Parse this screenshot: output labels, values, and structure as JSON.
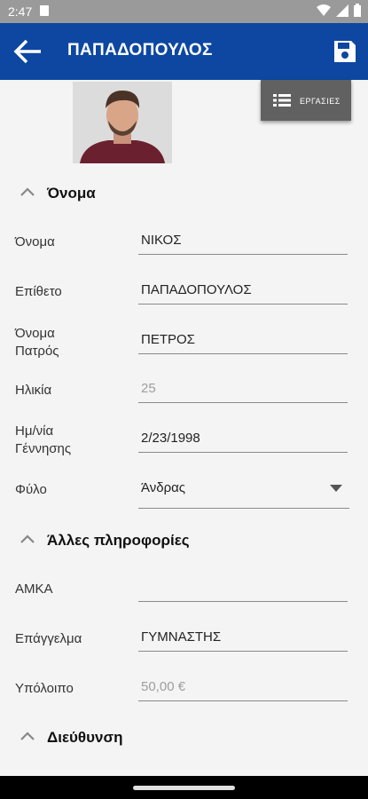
{
  "status_bar": {
    "time": "2:47"
  },
  "app_bar": {
    "title": "ΠΑΠΑΔΟΠΟΥΛΟΣ"
  },
  "tasks_button": {
    "label": "ΕΡΓΑΣΙΕΣ"
  },
  "sections": {
    "name": {
      "title": "Όνομα"
    },
    "other": {
      "title": "Άλλες πληροφορίες"
    },
    "address": {
      "title": "Διεύθυνση"
    }
  },
  "fields": {
    "first_name": {
      "label": "Όνομα",
      "value": "ΝΙΚΟΣ"
    },
    "last_name": {
      "label": "Επίθετο",
      "value": "ΠΑΠΑΔΟΠΟΥΛΟΣ"
    },
    "father_name": {
      "label_line1": "Όνομα",
      "label_line2": "Πατρός",
      "value": "ΠΕΤΡΟΣ"
    },
    "age": {
      "label": "Ηλικία",
      "value": "25"
    },
    "birth_date": {
      "label_line1": "Ημ/νία",
      "label_line2": "Γέννησης",
      "value": "2/23/1998"
    },
    "gender": {
      "label": "Φύλο",
      "value": "Άνδρας"
    },
    "amka": {
      "label": "ΑΜΚΑ",
      "value": ""
    },
    "profession": {
      "label": "Επάγγελμα",
      "value": "ΓΥΜΝΑΣΤΗΣ"
    },
    "balance": {
      "label": "Υπόλοιπο",
      "value": "50,00 €"
    }
  },
  "colors": {
    "app_bar": "#0d47a1",
    "status_bar": "#9a9a9a",
    "tasks_button": "#616161"
  }
}
